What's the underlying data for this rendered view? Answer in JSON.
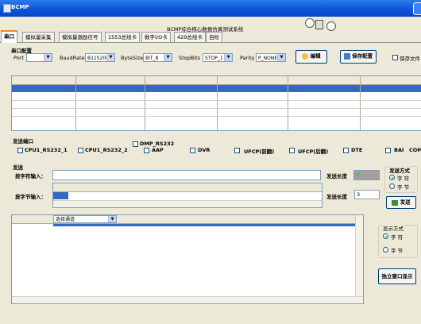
{
  "window": {
    "title": "BCMP"
  },
  "app_subtitle": "BCMP综合核心数据仿真测试系统",
  "tabs": [
    {
      "label": "串口"
    },
    {
      "label": "模拟量采集"
    },
    {
      "label": "模拟量激励信号"
    },
    {
      "label": "1553总线卡"
    },
    {
      "label": "数字I/O卡"
    },
    {
      "label": "429总线卡"
    },
    {
      "label": "自检"
    }
  ],
  "serial_config": {
    "section_label": "串口配置",
    "port_label": "Port",
    "port_value": "",
    "baud_label": "BaudRate",
    "baud_value": "B115200",
    "bytesize_label": "ByteSize",
    "bytesize_value": "BIT_8",
    "stopbits_label": "StopBits",
    "stopbits_value": "STOP_1",
    "parity_label": "Parity",
    "parity_value": "P_NONE",
    "edit_button": "编辑",
    "save_config_button": "保存配置",
    "save_file_label": "保存文件"
  },
  "send_ports": {
    "section_label": "发送端口",
    "items": [
      {
        "label": "CPU1_RS232_1"
      },
      {
        "label": "CPU1_RS232_2"
      },
      {
        "label": "DMP_RS232"
      },
      {
        "label": "AAP"
      },
      {
        "label": "DVR"
      },
      {
        "label": "UFCP(前翻)"
      },
      {
        "label": "UFCP(后翻)"
      },
      {
        "label": "DTE"
      },
      {
        "label": "BAI"
      },
      {
        "label": "COM"
      }
    ]
  },
  "send": {
    "section_label": "发送",
    "char_input_label": "按字符输入：",
    "byte_input_label": "按字节输入：",
    "send_len_label": "发送长度",
    "send_len_char_value": "0",
    "send_len_byte_value": "3",
    "mode_label": "发送方式",
    "mode_char": "字 符",
    "mode_byte": "字 节",
    "send_button": "发送"
  },
  "receive": {
    "channel_select": "选择通道",
    "display_mode_label": "显示方式",
    "display_char": "字 符",
    "display_byte": "字 节",
    "standalone_button": "独立窗口显示"
  }
}
